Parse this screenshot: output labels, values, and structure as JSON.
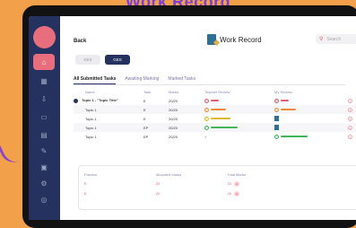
{
  "banner": "Work Record",
  "header": {
    "back": "Back",
    "title": "Work Record",
    "search_placeholder": "Search"
  },
  "segments": [
    "KES",
    "GES"
  ],
  "tabs": [
    "All Submitted Tasks",
    "Awaiting Marking",
    "Marked Tasks"
  ],
  "table": {
    "headers": [
      "Name",
      "Task",
      "Marks",
      "Teacher Review",
      "My Review"
    ],
    "rows": [
      {
        "name": "Topic 1 - \"Topic Title\"",
        "task": "E",
        "marks": "20/20",
        "teacher": "red",
        "mine": "red"
      },
      {
        "name": "Topic 1",
        "task": "E",
        "marks": "20/20",
        "teacher": "orange",
        "mine": "orange"
      },
      {
        "name": "Topic 1",
        "task": "E",
        "marks": "20/20",
        "teacher": "yellow",
        "mine": "edit"
      },
      {
        "name": "Topic 1",
        "task": "EP",
        "marks": "20/20",
        "teacher": "green",
        "mine": "edit"
      },
      {
        "name": "Topic 1",
        "task": "EP",
        "marks": "20/20",
        "teacher": "check",
        "mine": "green"
      }
    ]
  },
  "summary": {
    "headers": [
      "Practice",
      "Allocated Marks",
      "Total Marks"
    ],
    "rows": [
      [
        "E",
        "20",
        "20"
      ],
      [
        "E",
        "20",
        "20"
      ]
    ]
  },
  "colors": {
    "navy": "#25325f",
    "accent": "#e86d7d",
    "background": "#f2a14a"
  }
}
